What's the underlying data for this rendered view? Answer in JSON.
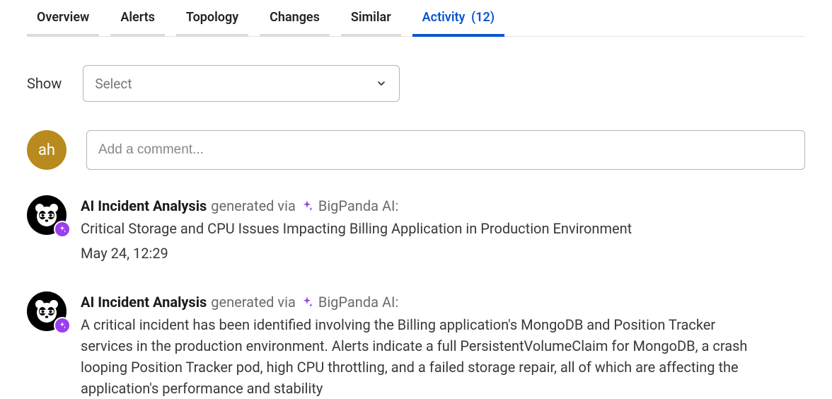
{
  "tabs": [
    {
      "label": "Overview",
      "active": false
    },
    {
      "label": "Alerts",
      "active": false
    },
    {
      "label": "Topology",
      "active": false
    },
    {
      "label": "Changes",
      "active": false
    },
    {
      "label": "Similar",
      "active": false
    },
    {
      "label": "Activity",
      "active": true,
      "count": "(12)"
    }
  ],
  "filter": {
    "label": "Show",
    "placeholder": "Select"
  },
  "commentBox": {
    "avatar": "ah",
    "placeholder": "Add a comment..."
  },
  "activity": [
    {
      "title": "AI Incident Analysis",
      "via": "generated via",
      "source": "BigPanda AI:",
      "body": "Critical Storage and CPU Issues Impacting Billing Application in Production Environment",
      "time": "May 24, 12:29"
    },
    {
      "title": "AI Incident Analysis",
      "via": "generated via",
      "source": "BigPanda AI:",
      "body": "A critical incident has been identified involving the Billing application's MongoDB and Position Tracker services in the production environment. Alerts indicate a full PersistentVolumeClaim for MongoDB, a crash looping Position Tracker pod, high CPU throttling, and a failed storage repair, all of which are affecting the application's performance and stability",
      "time": ""
    }
  ],
  "colors": {
    "tabActive": "#0b56d0",
    "avatarUser": "#b98a1e",
    "aiBadge": "#9b3df3"
  }
}
